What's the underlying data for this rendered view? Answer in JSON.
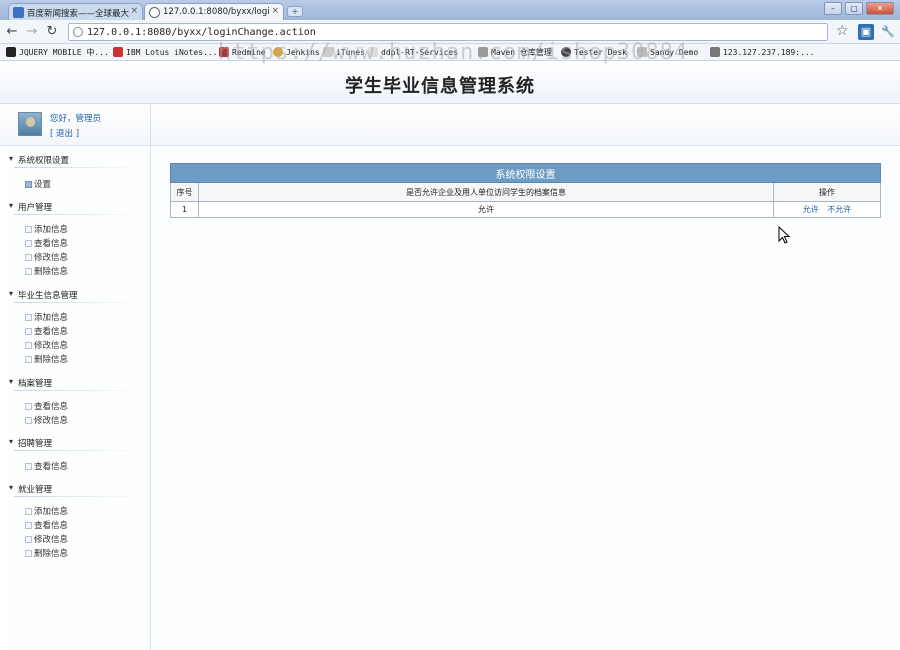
{
  "browser": {
    "tabs": [
      {
        "title": "百度新闻搜索——全球最大"
      },
      {
        "title": "127.0.0.1:8080/byxx/logi"
      }
    ],
    "new_tab": "+",
    "window_controls": [
      "–",
      "▢",
      "✕"
    ],
    "address": "127.0.0.1:8080/byxx/loginChange.action",
    "bookmarks": [
      "JQUERY MOBILE 中...",
      "IBM Lotus iNotes...",
      "Redmine",
      "Jenkins",
      "iTunes",
      "ddpl-RT-Services",
      "Maven 仓库管理",
      "Tester Desk",
      "Sandy Demo",
      "123.127.237.189:..."
    ]
  },
  "watermark": "https://www.huzhan.com/ishop30884",
  "site": {
    "title": "学生毕业信息管理系统"
  },
  "user": {
    "greeting": "您好，管理员",
    "logout": "[ 退出 ]"
  },
  "sidebar": {
    "groups": [
      {
        "label": "系统权限设置",
        "items": [
          "设置"
        ]
      },
      {
        "label": "用户管理",
        "items": [
          "添加信息",
          "查看信息",
          "修改信息",
          "删除信息"
        ]
      },
      {
        "label": "毕业生信息管理",
        "items": [
          "添加信息",
          "查看信息",
          "修改信息",
          "删除信息"
        ]
      },
      {
        "label": "档案管理",
        "items": [
          "查看信息",
          "修改信息"
        ]
      },
      {
        "label": "招聘管理",
        "items": [
          "查看信息"
        ]
      },
      {
        "label": "就业管理",
        "items": [
          "添加信息",
          "查看信息",
          "修改信息",
          "删除信息"
        ]
      }
    ]
  },
  "table": {
    "caption": "系统权限设置",
    "headers": [
      "序号",
      "是否允许企业及用人单位访问学生的档案信息",
      "操作"
    ],
    "rows": [
      {
        "index": "1",
        "value": "允许",
        "actions": [
          "允许",
          "不允许"
        ]
      }
    ]
  }
}
